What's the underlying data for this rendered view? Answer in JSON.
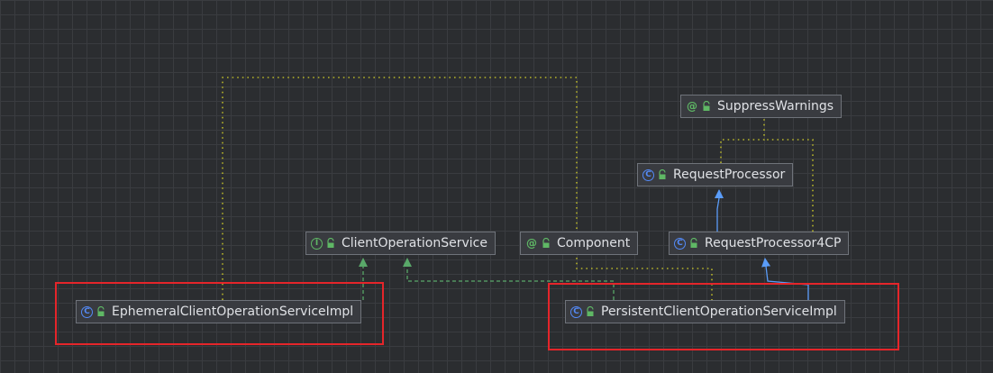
{
  "diagram": {
    "nodes": {
      "suppress_warnings": {
        "label": "SuppressWarnings",
        "kind": "annotation",
        "badge": "@"
      },
      "request_processor": {
        "label": "RequestProcessor",
        "kind": "class",
        "badge": "C"
      },
      "client_operation_service": {
        "label": "ClientOperationService",
        "kind": "interface",
        "badge": "I"
      },
      "component": {
        "label": "Component",
        "kind": "annotation",
        "badge": "@"
      },
      "request_processor_4cp": {
        "label": "RequestProcessor4CP",
        "kind": "class",
        "badge": "C"
      },
      "ephemeral_impl": {
        "label": "EphemeralClientOperationServiceImpl",
        "kind": "class",
        "badge": "C"
      },
      "persistent_impl": {
        "label": "PersistentClientOperationServiceImpl",
        "kind": "class",
        "badge": "C"
      }
    },
    "edges": [
      {
        "from": "request_processor_4cp",
        "to": "request_processor",
        "type": "extends"
      },
      {
        "from": "persistent_impl",
        "to": "request_processor_4cp",
        "type": "extends"
      },
      {
        "from": "ephemeral_impl",
        "to": "client_operation_service",
        "type": "implements"
      },
      {
        "from": "persistent_impl",
        "to": "client_operation_service",
        "type": "implements"
      },
      {
        "from": "request_processor",
        "to": "suppress_warnings",
        "type": "annotated"
      },
      {
        "from": "request_processor_4cp",
        "to": "suppress_warnings",
        "type": "annotated"
      },
      {
        "from": "ephemeral_impl",
        "to": "component",
        "type": "annotated"
      },
      {
        "from": "persistent_impl",
        "to": "component",
        "type": "annotated"
      }
    ],
    "highlighted": [
      "ephemeral_impl",
      "persistent_impl"
    ]
  },
  "colors": {
    "background": "#2b2d30",
    "extends": "#5a9cf8",
    "implements": "#59a869",
    "annotation_link": "#b5b32a",
    "highlight_box": "#e5252a",
    "class_icon": "#548af7",
    "interface_icon": "#5fb865",
    "annotation_icon": "#5fb865",
    "lock_icon": "#5fb865"
  }
}
